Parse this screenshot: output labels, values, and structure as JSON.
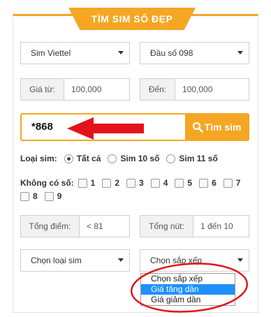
{
  "header": {
    "title": "TÌM SIM SỐ ĐẸP"
  },
  "network_select": {
    "value": "Sim Viettel"
  },
  "prefix_select": {
    "value": "Đầu số 098"
  },
  "price_from": {
    "label": "Giá từ:",
    "value": "100,000"
  },
  "price_to": {
    "label": "Đến:",
    "value": "100,000"
  },
  "search": {
    "query": "*868",
    "button_label": "Tìm sim"
  },
  "sim_type": {
    "label": "Loại sim:",
    "options": [
      "Tất cả",
      "Sim 10 số",
      "Sim 11 số"
    ],
    "selected": "Tất cả"
  },
  "exclude_digits": {
    "label": "Không có số:",
    "digits": [
      "1",
      "2",
      "3",
      "4",
      "5",
      "6",
      "7",
      "8",
      "9"
    ]
  },
  "total_points": {
    "label": "Tổng điểm:",
    "value": "< 81"
  },
  "total_nut": {
    "label": "Tổng nút:",
    "value": "1 đến 10"
  },
  "sim_kind_select": {
    "value": "Chọn loại sim"
  },
  "sort_select": {
    "value": "Chọn sắp xếp",
    "options": [
      "Chọn sắp xếp",
      "Giá tăng dần",
      "Giá giảm dần"
    ],
    "highlighted": "Giá tăng dần"
  },
  "colors": {
    "accent": "#f5a623",
    "annotation": "#e3131b",
    "highlight": "#1e90ff"
  }
}
